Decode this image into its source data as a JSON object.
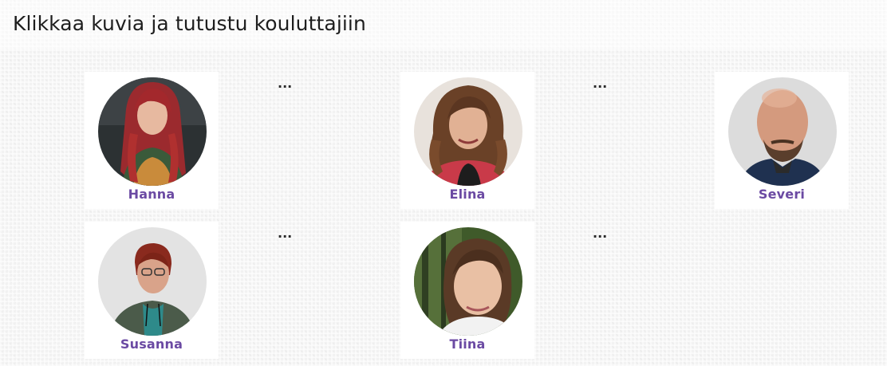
{
  "page": {
    "title": "Klikkaa kuvia ja tutustu kouluttajiin"
  },
  "colors": {
    "name_accent": "#6b4aa3",
    "card_background": "#ffffff"
  },
  "trainers": [
    {
      "name": "Hanna",
      "more": "..."
    },
    {
      "name": "Elina",
      "more": "..."
    },
    {
      "name": "Severi"
    },
    {
      "name": "Susanna",
      "more": "..."
    },
    {
      "name": "Tiina",
      "more": "..."
    }
  ]
}
